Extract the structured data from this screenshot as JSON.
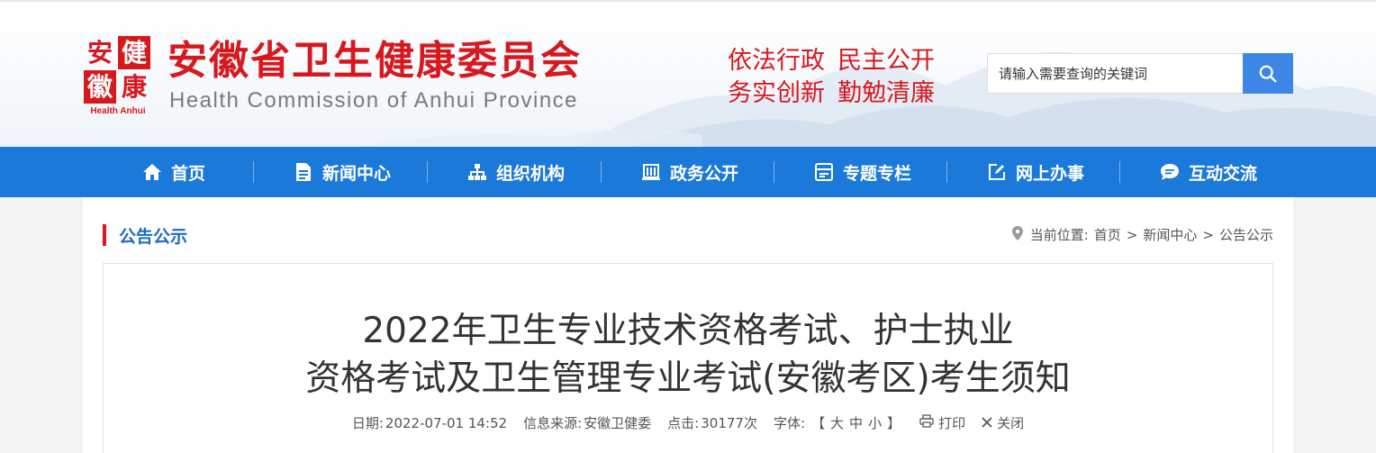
{
  "header": {
    "seal_chars": [
      "安",
      "健",
      "徽",
      "康"
    ],
    "seal_en": "Health Anhui",
    "title": "安徽省卫生健康委员会",
    "subtitle": "Health Commission of Anhui Province",
    "motto_line1": [
      "依法行政",
      "民主公开"
    ],
    "motto_line2": [
      "务实创新",
      "勤勉清廉"
    ],
    "search_placeholder": "请输入需要查询的关键词"
  },
  "nav": {
    "items": [
      {
        "label": "首页",
        "icon": "home-icon"
      },
      {
        "label": "新闻中心",
        "icon": "document-icon"
      },
      {
        "label": "组织机构",
        "icon": "org-chart-icon"
      },
      {
        "label": "政务公开",
        "icon": "building-icon"
      },
      {
        "label": "专题专栏",
        "icon": "topic-icon"
      },
      {
        "label": "网上办事",
        "icon": "edit-icon"
      },
      {
        "label": "互动交流",
        "icon": "chat-icon"
      }
    ]
  },
  "section": {
    "title": "公告公示",
    "breadcrumb_label": "当前位置:",
    "breadcrumb": [
      "首页",
      "新闻中心",
      "公告公示"
    ],
    "breadcrumb_sep": ">"
  },
  "article": {
    "title_line1": "2022年卫生专业技术资格考试、护士执业",
    "title_line2": "资格考试及卫生管理专业考试(安徽考区)考生须知",
    "date_label": "日期:",
    "date": "2022-07-01 14:52",
    "source_label": "信息来源:",
    "source": "安徽卫健委",
    "clicks_label": "点击:",
    "clicks": "30177次",
    "font_label": "字体:",
    "font_open": "【",
    "font_sizes": [
      "大",
      "中",
      "小"
    ],
    "font_close": "】",
    "print_label": "打印",
    "close_label": "关闭"
  },
  "colors": {
    "brand_red": "#d7191e",
    "nav_blue": "#1b79d9",
    "search_blue": "#3d86e6",
    "section_title_blue": "#1b68c9"
  }
}
